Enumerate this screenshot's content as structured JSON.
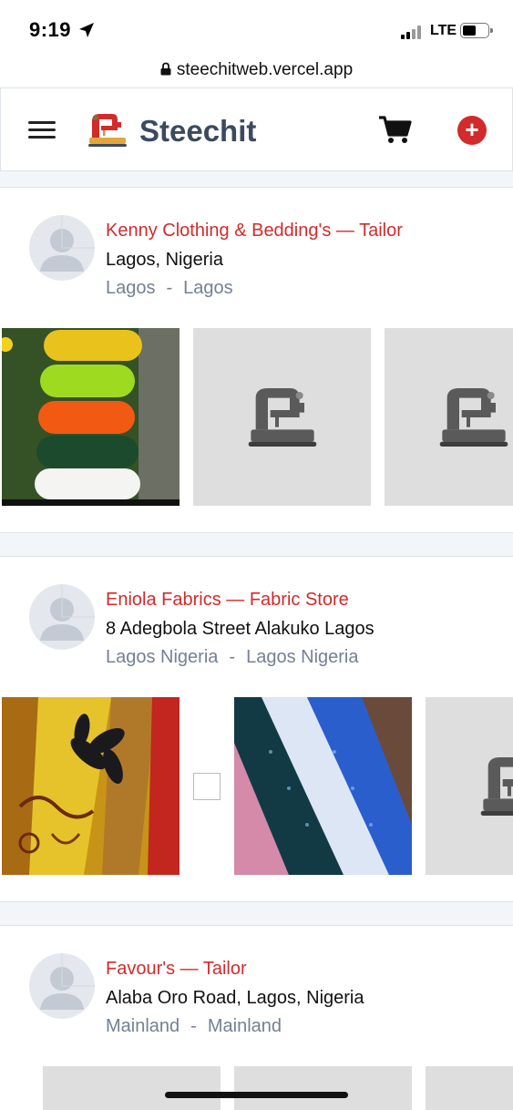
{
  "status_bar": {
    "time": "9:19",
    "network": "LTE"
  },
  "browser": {
    "url": "steechitweb.vercel.app"
  },
  "header": {
    "brand": "Steechit",
    "add_label": "+"
  },
  "stores": [
    {
      "name": "Kenny Clothing & Bedding's — Tailor",
      "address": "Lagos, Nigeria",
      "area": "Lagos",
      "separator": "-",
      "city": "Lagos"
    },
    {
      "name": "Eniola Fabrics — Fabric Store",
      "address": "8 Adegbola Street Alakuko Lagos",
      "area": "Lagos Nigeria",
      "separator": "-",
      "city": "Lagos Nigeria"
    },
    {
      "name": "Favour's — Tailor",
      "address": "Alaba Oro Road, Lagos, Nigeria",
      "area": "Mainland",
      "separator": "-",
      "city": "Mainland"
    }
  ],
  "colors": {
    "accent": "#d22b2b",
    "brand_text": "#3c4a5e",
    "muted": "#748094"
  }
}
